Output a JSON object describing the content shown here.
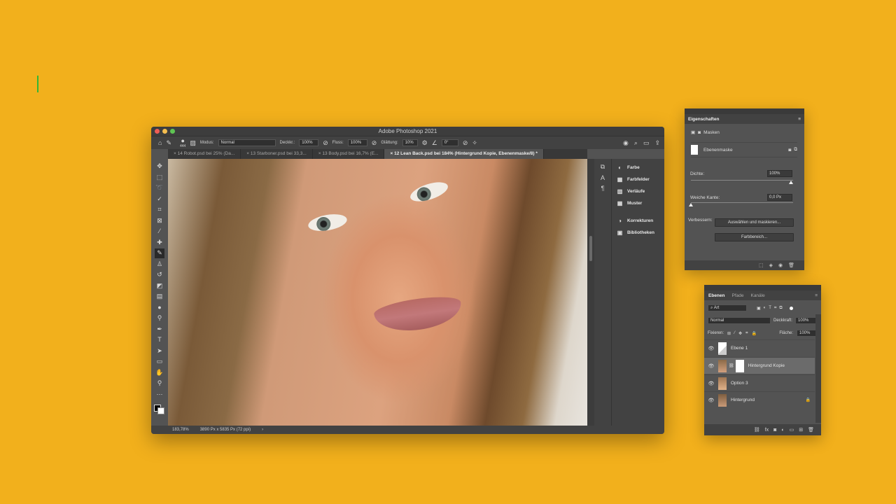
{
  "window": {
    "title": "Adobe Photoshop 2021"
  },
  "options_bar": {
    "brush_size": "444",
    "mode_label": "Modus:",
    "mode_value": "Normal",
    "opacity_label": "Deckkr.:",
    "opacity_value": "100%",
    "flow_label": "Fluss:",
    "flow_value": "100%",
    "smoothing_label": "Glättung:",
    "smoothing_value": "10%",
    "angle_value": "0°"
  },
  "doc_tabs": [
    {
      "label": "14 Robot.psd bei 25% (Da..."
    },
    {
      "label": "13 Starboner.psd bei 33,3..."
    },
    {
      "label": "13 Body.psd bei 16,7% (E..."
    },
    {
      "label": "12 Lean Back.psd bei 184% (Hintergrund Kopie, Ebenenmaske/8) *"
    }
  ],
  "panel_list": {
    "items": [
      "Farbe",
      "Farbfelder",
      "Verläufe",
      "Muster",
      "Korrekturen",
      "Bibliotheken"
    ]
  },
  "status_bar": {
    "zoom": "183,78%",
    "doc_size": "3890 Px x 5835 Px (72 ppi)"
  },
  "properties": {
    "title": "Eigenschaften",
    "section": "Masken",
    "mask_type": "Ebenenmaske",
    "density_label": "Dichte:",
    "density_value": "100%",
    "density_level": 1.0,
    "feather_label": "Weiche Kante:",
    "feather_value": "0,0 Px",
    "feather_level": 0.0,
    "refine_label": "Verbessern:",
    "btn_select_mask": "Auswählen und maskieren...",
    "btn_color_range": "Farbbereich..."
  },
  "layers": {
    "tabs": [
      "Ebenen",
      "Pfade",
      "Kanäle"
    ],
    "filter": "Art",
    "blend_mode": "Normal",
    "opacity_label": "Deckkraft:",
    "opacity_value": "100%",
    "lock_label": "Fixieren:",
    "fill_label": "Fläche:",
    "fill_value": "100%",
    "items": [
      {
        "name": "Ebene 1"
      },
      {
        "name": "Hintergrund Kopie"
      },
      {
        "name": "Option 3"
      },
      {
        "name": "Hintergrund"
      }
    ]
  },
  "colors": {
    "background": "#f2b01c",
    "panel": "#535353",
    "panel_dark": "#424242"
  }
}
